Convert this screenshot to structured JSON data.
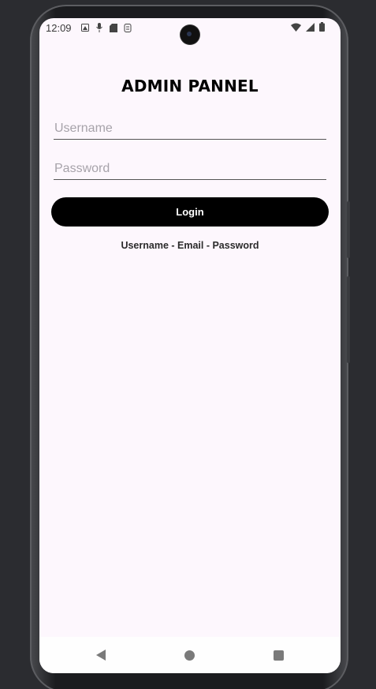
{
  "status_bar": {
    "time": "12:09",
    "left_icons": [
      "photo-icon",
      "mic-icon",
      "sd-card-icon",
      "sim-icon"
    ],
    "right_icons": [
      "wifi-icon",
      "signal-icon",
      "battery-icon"
    ]
  },
  "page": {
    "title": "ADMIN PANNEL",
    "username_placeholder": "Username",
    "password_placeholder": "Password",
    "login_label": "Login",
    "hint_text": "Username - Email - Password"
  },
  "nav_bar": {
    "buttons": [
      "back-icon",
      "home-icon",
      "recents-icon"
    ]
  },
  "colors": {
    "background": "#fdf7fd",
    "button": "#000000",
    "button_text": "#ffffff",
    "placeholder": "#a7a3aa"
  }
}
